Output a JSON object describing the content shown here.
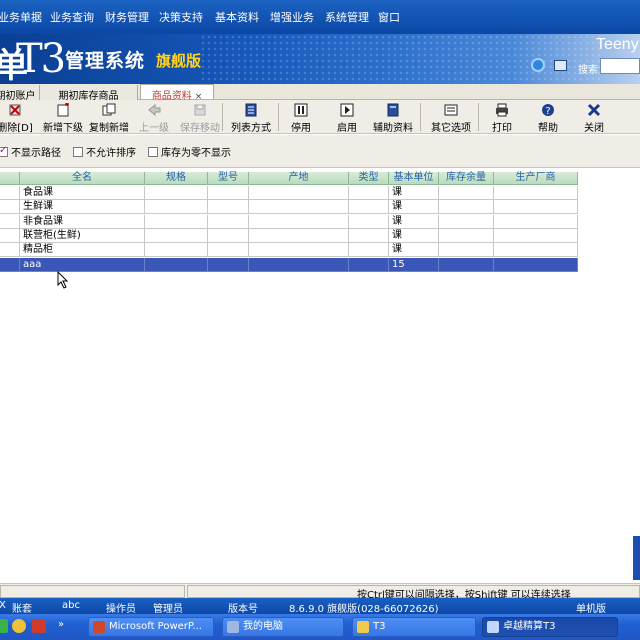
{
  "menu": {
    "items": [
      "业务单据",
      "业务查询",
      "财务管理",
      "决策支持",
      "基本资料",
      "增强业务",
      "系统管理",
      "窗口"
    ]
  },
  "banner": {
    "logo_char": "单",
    "logo_t3": "T3",
    "title": "管理系统",
    "edition": "旗舰版",
    "brand": "Teeny",
    "search_label": "搜索"
  },
  "tabs": [
    {
      "label": "期初账户"
    },
    {
      "label": "期初库存商品"
    },
    {
      "label": "商品资料",
      "close": "×"
    }
  ],
  "toolbar": {
    "items": [
      {
        "label": "删除[D]",
        "icon": "delete-icon",
        "enabled": true
      },
      {
        "label": "新增下级",
        "icon": "add-child-icon",
        "enabled": true
      },
      {
        "label": "复制新增",
        "icon": "copy-add-icon",
        "enabled": true
      },
      {
        "label": "上一级",
        "icon": "back-arrow-icon",
        "enabled": false
      },
      {
        "label": "保存移动",
        "icon": "save-icon",
        "enabled": false
      },
      {
        "label": "列表方式",
        "icon": "list-view-icon",
        "enabled": true
      },
      {
        "label": "停用",
        "icon": "pause-icon",
        "enabled": true
      },
      {
        "label": "启用",
        "icon": "play-icon",
        "enabled": true
      },
      {
        "label": "辅助资料",
        "icon": "book-icon",
        "enabled": true
      },
      {
        "label": "其它选项",
        "icon": "options-icon",
        "enabled": true
      },
      {
        "label": "打印",
        "icon": "printer-icon",
        "enabled": true
      },
      {
        "label": "帮助",
        "icon": "help-icon",
        "enabled": true
      },
      {
        "label": "关闭",
        "icon": "close-icon",
        "enabled": true
      }
    ]
  },
  "options": [
    {
      "label": "不显示路径",
      "checked": true
    },
    {
      "label": "不允许排序",
      "checked": false
    },
    {
      "label": "库存为零不显示",
      "checked": false
    }
  ],
  "table": {
    "columns": [
      "全名",
      "规格",
      "型号",
      "产地",
      "类型",
      "基本单位",
      "库存余量",
      "生产厂商"
    ],
    "rows": [
      [
        "食品课",
        "",
        "",
        "",
        "",
        "课",
        "",
        ""
      ],
      [
        "生鲜课",
        "",
        "",
        "",
        "",
        "课",
        "",
        ""
      ],
      [
        "非食品课",
        "",
        "",
        "",
        "",
        "课",
        "",
        ""
      ],
      [
        "联营柜(生鲜)",
        "",
        "",
        "",
        "",
        "课",
        "",
        ""
      ],
      [
        "精品柜",
        "",
        "",
        "",
        "",
        "课",
        "",
        ""
      ],
      [
        "aaa",
        "",
        "",
        "",
        "",
        "15",
        "",
        ""
      ]
    ],
    "selected_row": 5
  },
  "hint": "按Ctrl键可以间隔选择，按Shift键 可以连续选择",
  "status": {
    "x_label": "X",
    "account_label": "账套",
    "account_value": "abc",
    "operator_label": "操作员",
    "operator_value": "管理员",
    "version_label": "版本号",
    "version_value": "8.6.9.0 旗舰版(028-66072626)",
    "mode": "单机版"
  },
  "taskbar": {
    "tasks": [
      {
        "label": "Microsoft PowerP...",
        "icon": "powerpoint-icon",
        "color": "#d24726"
      },
      {
        "label": "我的电脑",
        "icon": "computer-icon",
        "color": "#9fb8e0"
      },
      {
        "label": "T3",
        "icon": "folder-icon",
        "color": "#f2c94c"
      },
      {
        "label": "卓越精算T3",
        "icon": "app-icon",
        "color": "#c0d8ff"
      }
    ]
  },
  "colors": {
    "menu_bg": "#0b47a6",
    "header_text": "#2860a8",
    "selected_row": "#3a57b8",
    "active_tab_text": "#c0392b"
  }
}
